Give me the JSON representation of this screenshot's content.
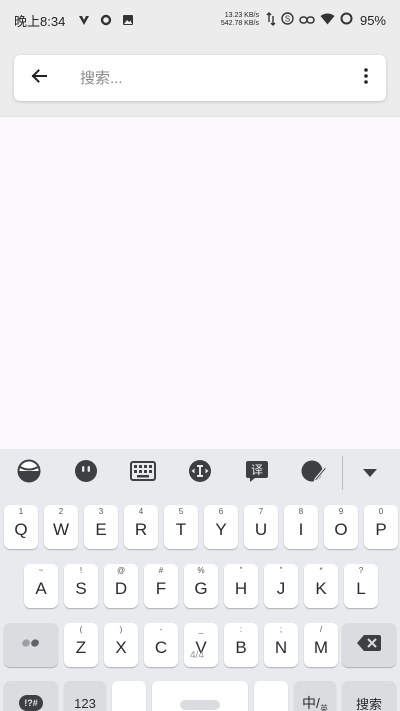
{
  "status_bar": {
    "time": "晚上8:34",
    "upload_speed": "13.23 KB/s",
    "download_speed": "542.78 KB/s",
    "battery": "95%"
  },
  "search": {
    "placeholder": "搜索..."
  },
  "keyboard": {
    "row1": [
      {
        "key": "Q",
        "hint": "1"
      },
      {
        "key": "W",
        "hint": "2"
      },
      {
        "key": "E",
        "hint": "3"
      },
      {
        "key": "R",
        "hint": "4"
      },
      {
        "key": "T",
        "hint": "5"
      },
      {
        "key": "Y",
        "hint": "6"
      },
      {
        "key": "U",
        "hint": "7"
      },
      {
        "key": "I",
        "hint": "8"
      },
      {
        "key": "O",
        "hint": "9"
      },
      {
        "key": "P",
        "hint": "0"
      }
    ],
    "row2": [
      {
        "key": "A",
        "hint": "~"
      },
      {
        "key": "S",
        "hint": "!"
      },
      {
        "key": "D",
        "hint": "@"
      },
      {
        "key": "F",
        "hint": "#"
      },
      {
        "key": "G",
        "hint": "%"
      },
      {
        "key": "H",
        "hint": "\""
      },
      {
        "key": "J",
        "hint": "\""
      },
      {
        "key": "K",
        "hint": "*"
      },
      {
        "key": "L",
        "hint": "?"
      }
    ],
    "row3": [
      {
        "key": "Z",
        "hint": "("
      },
      {
        "key": "X",
        "hint": ")"
      },
      {
        "key": "C",
        "hint": "-"
      },
      {
        "key": "V",
        "hint": "_"
      },
      {
        "key": "B",
        "hint": ":"
      },
      {
        "key": "N",
        "hint": ";"
      },
      {
        "key": "M",
        "hint": "/"
      }
    ],
    "symbols_label": "!?#",
    "numbers_label": "123",
    "lang_label": "中/",
    "lang_sub": "英",
    "search_label": "搜索",
    "watermark": "4/4"
  }
}
